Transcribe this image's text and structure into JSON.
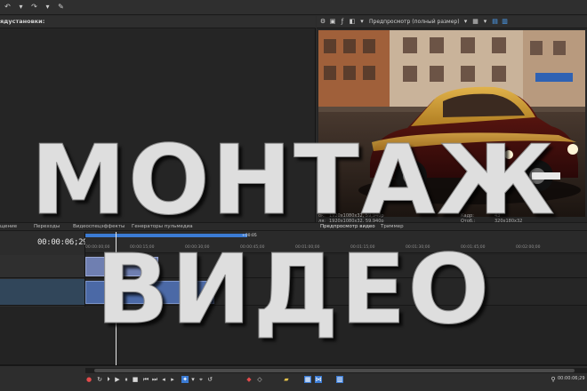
{
  "overlay": {
    "line1": "МОНТАЖ",
    "line2": "ВИДЕО"
  },
  "toolbar": {
    "buttons": [
      "undo-icon",
      "redo-icon",
      "cut-icon"
    ]
  },
  "left_panel": {
    "header_label": "ядустановки:"
  },
  "preview": {
    "mode_label": "Предпросмотр (полный размер)",
    "stats_left": [
      "ок:",
      "ля:",
      "ла:",
      "ек:"
    ],
    "stats_mid": [
      "1920x1080x32, 59,940p",
      "1920x1080x32, 59,940p",
      "1920x1080x32, 59,940p"
    ],
    "stats_right": [
      "Кадр:",
      "Отоб.:",
      "",
      "Кадр:"
    ],
    "stats_vals": [
      "43",
      "320x180x32",
      "759x240"
    ],
    "preview_tab": "Предпросмотр видео",
    "trimmer_tab": "Триммер"
  },
  "tabs": {
    "items": [
      "щение",
      "Переходы",
      "Видеоспецэффекты",
      "Генераторы пульмедиа"
    ]
  },
  "timeline": {
    "timecode": "00:00:06;29",
    "marker": "+00:05",
    "ticks": [
      "00:00:00;00",
      "00:00:15;00",
      "00:00:30;00",
      "00:00:45;00",
      "00:01:00;00",
      "00:01:15;00",
      "00:01:30;00",
      "00:01:45;00",
      "00:02:00;00"
    ]
  },
  "transport": {
    "timecode": "00:00:06;29",
    "rate": "Rate"
  }
}
